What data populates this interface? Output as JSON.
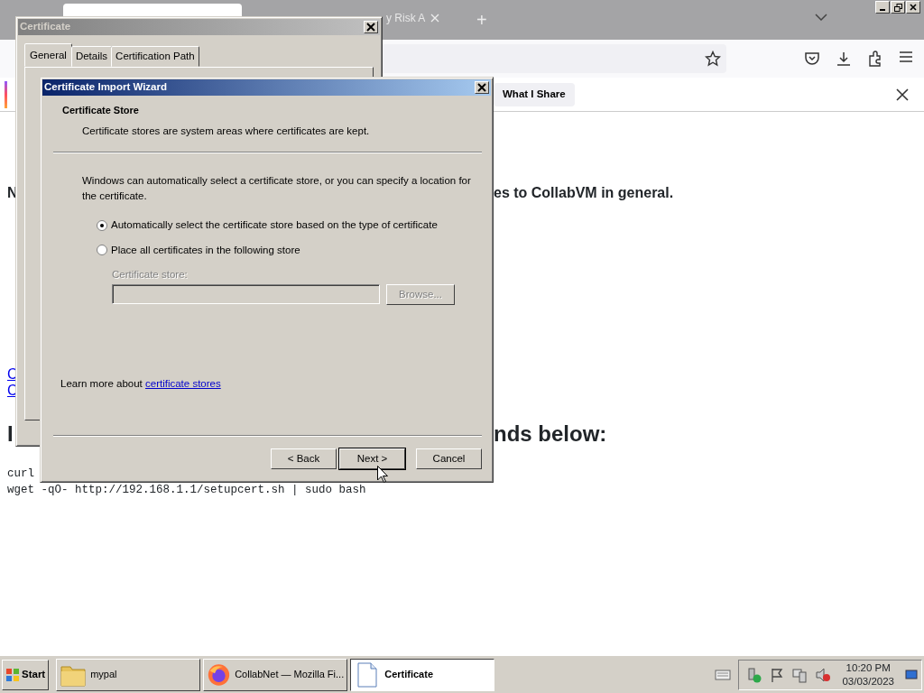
{
  "browser": {
    "tabs": [
      {
        "selected": true
      },
      {
        "label": "y Risk A",
        "selected": false
      }
    ],
    "new_tab": "+",
    "notification": {
      "label": "What I Share"
    },
    "page": [
      {
        "kind": "h1"
      },
      {
        "kind": "p",
        "text": "N",
        "tail": "es to CollabVM in general."
      },
      {
        "kind": "h2"
      },
      {
        "kind": "h2"
      },
      {
        "kind": "link",
        "text": "C"
      },
      {
        "kind": "link",
        "text": "C"
      },
      {
        "kind": "h2",
        "text": "I",
        "tail": "nds below:"
      },
      {
        "kind": "code",
        "text": "curl"
      },
      {
        "kind": "code",
        "text": "wget -qO- http://192.168.1.1/setupcert.sh | sudo bash"
      }
    ]
  },
  "certificate_dialog": {
    "title": "Certificate",
    "tabs": [
      {
        "label": "General",
        "selected": true
      },
      {
        "label": "Details",
        "selected": false
      },
      {
        "label": "Certification Path",
        "selected": false
      }
    ]
  },
  "wizard": {
    "title": "Certificate Import Wizard",
    "heading": "Certificate Store",
    "subtitle": "Certificate stores are system areas where certificates are kept.",
    "intro": "Windows can automatically select a certificate store, or you can specify a location for the certificate.",
    "options": [
      {
        "label": "Automatically select the certificate store based on the type of certificate",
        "selected": true
      },
      {
        "label": "Place all certificates in the following store",
        "selected": false
      }
    ],
    "store": {
      "label": "Certificate store:",
      "browse": "Browse...",
      "disabled": true
    },
    "learn_more": "Learn more about ",
    "learn_link": "certificate stores",
    "buttons": [
      {
        "label": "< Back",
        "default": false
      },
      {
        "label": "Next >",
        "default": true
      },
      {
        "label": "Cancel",
        "default": false
      }
    ]
  },
  "taskbar": {
    "start": "Start",
    "buttons": [
      {
        "kind": "folder",
        "label": "mypal",
        "selected": false
      },
      {
        "kind": "firefox",
        "label": "CollabNet — Mozilla Fi...",
        "selected": false
      },
      {
        "kind": "document",
        "label": "Certificate",
        "selected": true
      }
    ],
    "time": "10:20 PM",
    "date": "03/03/2023"
  }
}
